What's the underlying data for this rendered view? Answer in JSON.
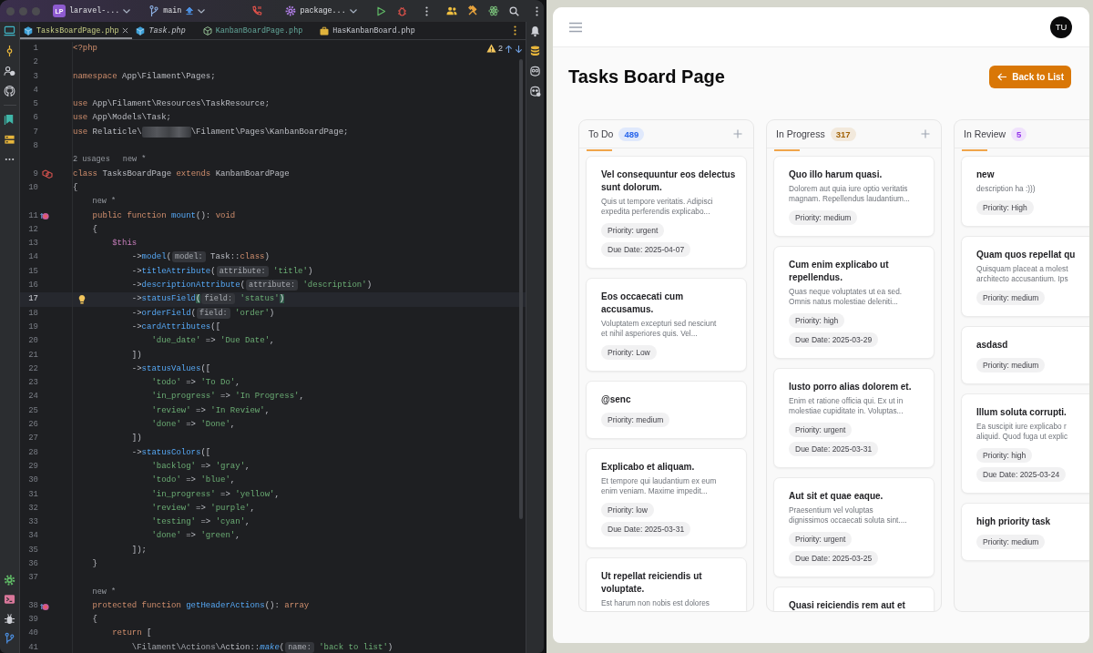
{
  "ide": {
    "title_bar": {
      "project_badge": "LP",
      "project": "laravel-...",
      "branch": "main",
      "run_config": "package..."
    },
    "tabs": [
      {
        "label": "TasksBoardPage.php",
        "kind": "class",
        "selected": true,
        "preview": false,
        "added": true,
        "library": false
      },
      {
        "label": "Task.php",
        "kind": "class",
        "selected": false,
        "preview": true,
        "added": false,
        "library": false
      },
      {
        "label": "KanbanBoardPage.php",
        "kind": "abstract",
        "selected": false,
        "preview": false,
        "added": false,
        "library": true
      },
      {
        "label": "HasKanbanBoard.php",
        "kind": "trait",
        "selected": false,
        "preview": false,
        "added": false,
        "library": false
      }
    ],
    "warnings": "2",
    "lines": [
      {
        "number": "1",
        "kind": "code",
        "current": false,
        "tokens": [
          {
            "text": "<?php",
            "kind": "kw"
          }
        ]
      },
      {
        "number": "2",
        "kind": "code",
        "current": false
      },
      {
        "number": "3",
        "kind": "code",
        "current": false,
        "tokens": [
          {
            "text": "namespace",
            "kind": "kw"
          },
          {
            "text": " App\\Filament\\Pages;",
            "kind": "id"
          }
        ]
      },
      {
        "number": "4",
        "kind": "code",
        "current": false
      },
      {
        "number": "5",
        "kind": "code",
        "current": false,
        "tokens": [
          {
            "text": "use",
            "kind": "kw"
          },
          {
            "text": " App\\Filament\\Resources\\TaskResource;",
            "kind": "id"
          }
        ]
      },
      {
        "number": "6",
        "kind": "code",
        "current": false,
        "tokens": [
          {
            "text": "use",
            "kind": "kw"
          },
          {
            "text": " App\\Models\\Task;",
            "kind": "id"
          }
        ]
      },
      {
        "number": "7",
        "kind": "code",
        "current": false,
        "tokens": [
          {
            "text": "use",
            "kind": "kw"
          },
          {
            "text": " Relaticle\\",
            "kind": "id"
          },
          {
            "kind": "redacted"
          },
          {
            "text": "\\Filament\\Pages\\KanbanBoardPage;",
            "kind": "id"
          }
        ]
      },
      {
        "number": "8",
        "kind": "code",
        "current": false
      },
      {
        "number": "9",
        "kind": "class",
        "current": false,
        "inlay": [
          "2 usages",
          "new *"
        ],
        "tokens": [
          {
            "text": "class",
            "kind": "kw"
          },
          {
            "text": " TasksBoardPage ",
            "kind": "id"
          },
          {
            "text": "extends",
            "kind": "kw"
          },
          {
            "text": " KanbanBoardPage",
            "kind": "id"
          }
        ]
      },
      {
        "number": "10",
        "kind": "code",
        "current": false,
        "tokens": [
          {
            "text": "{",
            "kind": "id"
          }
        ]
      },
      {
        "number": "11",
        "kind": "method",
        "current": false,
        "inlay": [
          "new *"
        ],
        "tokens": [
          {
            "text": "    public function ",
            "kind": "kw"
          },
          {
            "text": "mount",
            "kind": "fn"
          },
          {
            "text": "(): ",
            "kind": "id"
          },
          {
            "text": "void",
            "kind": "kw"
          }
        ]
      },
      {
        "number": "12",
        "kind": "code",
        "current": false,
        "tokens": [
          {
            "text": "    {",
            "kind": "id"
          }
        ]
      },
      {
        "number": "13",
        "kind": "code",
        "current": false,
        "tokens": [
          {
            "text": "        $this",
            "kind": "var"
          }
        ]
      },
      {
        "number": "14",
        "kind": "code",
        "current": false,
        "tokens": [
          {
            "text": "            ->",
            "kind": "id"
          },
          {
            "text": "model",
            "kind": "fn"
          },
          {
            "text": "(",
            "kind": "id"
          },
          {
            "text": "model:",
            "kind": "hint"
          },
          {
            "text": " Task::",
            "kind": "id"
          },
          {
            "text": "class",
            "kind": "kw"
          },
          {
            "text": ")",
            "kind": "id"
          }
        ]
      },
      {
        "number": "15",
        "kind": "code",
        "current": false,
        "tokens": [
          {
            "text": "            ->",
            "kind": "id"
          },
          {
            "text": "titleAttribute",
            "kind": "fn"
          },
          {
            "text": "(",
            "kind": "id"
          },
          {
            "text": "attribute:",
            "kind": "hint"
          },
          {
            "text": " 'title'",
            "kind": "str"
          },
          {
            "text": ")",
            "kind": "id"
          }
        ]
      },
      {
        "number": "16",
        "kind": "code",
        "current": false,
        "tokens": [
          {
            "text": "            ->",
            "kind": "id"
          },
          {
            "text": "descriptionAttribute",
            "kind": "fn"
          },
          {
            "text": "(",
            "kind": "id"
          },
          {
            "text": "attribute:",
            "kind": "hint"
          },
          {
            "text": " 'description'",
            "kind": "str"
          },
          {
            "text": ")",
            "kind": "id"
          }
        ]
      },
      {
        "number": "17",
        "kind": "code",
        "current": true,
        "tokens": [
          {
            "text": "            ->",
            "kind": "id"
          },
          {
            "text": "statusField",
            "kind": "fn"
          },
          {
            "text": "(",
            "kind": "match"
          },
          {
            "text": "field:",
            "kind": "hint"
          },
          {
            "text": " 'status'",
            "kind": "str"
          },
          {
            "text": ")",
            "kind": "match"
          }
        ]
      },
      {
        "number": "18",
        "kind": "code",
        "current": false,
        "tokens": [
          {
            "text": "            ->",
            "kind": "id"
          },
          {
            "text": "orderField",
            "kind": "fn"
          },
          {
            "text": "(",
            "kind": "id"
          },
          {
            "text": "field:",
            "kind": "hint"
          },
          {
            "text": " 'order'",
            "kind": "str"
          },
          {
            "text": ")",
            "kind": "id"
          }
        ]
      },
      {
        "number": "19",
        "kind": "code",
        "current": false,
        "tokens": [
          {
            "text": "            ->",
            "kind": "id"
          },
          {
            "text": "cardAttributes",
            "kind": "fn"
          },
          {
            "text": "([",
            "kind": "id"
          }
        ]
      },
      {
        "number": "20",
        "kind": "code",
        "current": false,
        "tokens": [
          {
            "text": "                'due_date'",
            "kind": "str"
          },
          {
            "text": " => ",
            "kind": "id"
          },
          {
            "text": "'Due Date'",
            "kind": "str"
          },
          {
            "text": ",",
            "kind": "id"
          }
        ]
      },
      {
        "number": "21",
        "kind": "code",
        "current": false,
        "tokens": [
          {
            "text": "            ])",
            "kind": "id"
          }
        ]
      },
      {
        "number": "22",
        "kind": "code",
        "current": false,
        "tokens": [
          {
            "text": "            ->",
            "kind": "id"
          },
          {
            "text": "statusValues",
            "kind": "fn"
          },
          {
            "text": "([",
            "kind": "id"
          }
        ]
      },
      {
        "number": "23",
        "kind": "code",
        "current": false,
        "tokens": [
          {
            "text": "                'todo'",
            "kind": "str"
          },
          {
            "text": " => ",
            "kind": "id"
          },
          {
            "text": "'To Do'",
            "kind": "str"
          },
          {
            "text": ",",
            "kind": "id"
          }
        ]
      },
      {
        "number": "24",
        "kind": "code",
        "current": false,
        "tokens": [
          {
            "text": "                'in_progress'",
            "kind": "str"
          },
          {
            "text": " => ",
            "kind": "id"
          },
          {
            "text": "'In Progress'",
            "kind": "str"
          },
          {
            "text": ",",
            "kind": "id"
          }
        ]
      },
      {
        "number": "25",
        "kind": "code",
        "current": false,
        "tokens": [
          {
            "text": "                'review'",
            "kind": "str"
          },
          {
            "text": " => ",
            "kind": "id"
          },
          {
            "text": "'In Review'",
            "kind": "str"
          },
          {
            "text": ",",
            "kind": "id"
          }
        ]
      },
      {
        "number": "26",
        "kind": "code",
        "current": false,
        "tokens": [
          {
            "text": "                'done'",
            "kind": "str"
          },
          {
            "text": " => ",
            "kind": "id"
          },
          {
            "text": "'Done'",
            "kind": "str"
          },
          {
            "text": ",",
            "kind": "id"
          }
        ]
      },
      {
        "number": "27",
        "kind": "code",
        "current": false,
        "tokens": [
          {
            "text": "            ])",
            "kind": "id"
          }
        ]
      },
      {
        "number": "28",
        "kind": "code",
        "current": false,
        "tokens": [
          {
            "text": "            ->",
            "kind": "id"
          },
          {
            "text": "statusColors",
            "kind": "fn"
          },
          {
            "text": "([",
            "kind": "id"
          }
        ]
      },
      {
        "number": "29",
        "kind": "code",
        "current": false,
        "tokens": [
          {
            "text": "                'backlog'",
            "kind": "str"
          },
          {
            "text": " => ",
            "kind": "id"
          },
          {
            "text": "'gray'",
            "kind": "str"
          },
          {
            "text": ",",
            "kind": "id"
          }
        ]
      },
      {
        "number": "30",
        "kind": "code",
        "current": false,
        "tokens": [
          {
            "text": "                'todo'",
            "kind": "str"
          },
          {
            "text": " => ",
            "kind": "id"
          },
          {
            "text": "'blue'",
            "kind": "str"
          },
          {
            "text": ",",
            "kind": "id"
          }
        ]
      },
      {
        "number": "31",
        "kind": "code",
        "current": false,
        "tokens": [
          {
            "text": "                'in_progress'",
            "kind": "str"
          },
          {
            "text": " => ",
            "kind": "id"
          },
          {
            "text": "'yellow'",
            "kind": "str"
          },
          {
            "text": ",",
            "kind": "id"
          }
        ]
      },
      {
        "number": "32",
        "kind": "code",
        "current": false,
        "tokens": [
          {
            "text": "                'review'",
            "kind": "str"
          },
          {
            "text": " => ",
            "kind": "id"
          },
          {
            "text": "'purple'",
            "kind": "str"
          },
          {
            "text": ",",
            "kind": "id"
          }
        ]
      },
      {
        "number": "33",
        "kind": "code",
        "current": false,
        "tokens": [
          {
            "text": "                'testing'",
            "kind": "str"
          },
          {
            "text": " => ",
            "kind": "id"
          },
          {
            "text": "'cyan'",
            "kind": "str"
          },
          {
            "text": ",",
            "kind": "id"
          }
        ]
      },
      {
        "number": "34",
        "kind": "code",
        "current": false,
        "tokens": [
          {
            "text": "                'done'",
            "kind": "str"
          },
          {
            "text": " => ",
            "kind": "id"
          },
          {
            "text": "'green'",
            "kind": "str"
          },
          {
            "text": ",",
            "kind": "id"
          }
        ]
      },
      {
        "number": "35",
        "kind": "code",
        "current": false,
        "tokens": [
          {
            "text": "            ]);",
            "kind": "id"
          }
        ]
      },
      {
        "number": "36",
        "kind": "code",
        "current": false,
        "tokens": [
          {
            "text": "    }",
            "kind": "id"
          }
        ]
      },
      {
        "number": "37",
        "kind": "code",
        "current": false
      },
      {
        "number": "38",
        "kind": "method",
        "current": false,
        "inlay": [
          "new *"
        ],
        "tokens": [
          {
            "text": "    protected function ",
            "kind": "kw"
          },
          {
            "text": "getHeaderActions",
            "kind": "fn"
          },
          {
            "text": "(): ",
            "kind": "id"
          },
          {
            "text": "array",
            "kind": "kw"
          }
        ]
      },
      {
        "number": "39",
        "kind": "code",
        "current": false,
        "tokens": [
          {
            "text": "    {",
            "kind": "id"
          }
        ]
      },
      {
        "number": "40",
        "kind": "code",
        "current": false,
        "tokens": [
          {
            "text": "        return",
            "kind": "kw"
          },
          {
            "text": " [",
            "kind": "id"
          }
        ]
      },
      {
        "number": "41",
        "kind": "code",
        "current": false,
        "tokens": [
          {
            "text": "            \\Filament\\Actions\\",
            "kind": "dim"
          },
          {
            "text": "Action::",
            "kind": "id"
          },
          {
            "text": "make",
            "kind": "static"
          },
          {
            "text": "(",
            "kind": "id"
          },
          {
            "text": "name:",
            "kind": "hint"
          },
          {
            "text": " 'back to list'",
            "kind": "str"
          },
          {
            "text": ")",
            "kind": "id"
          }
        ]
      }
    ]
  },
  "app": {
    "avatar": "TU",
    "title": "Tasks Board Page",
    "action": "Back to List",
    "columns": [
      {
        "title": "To Do",
        "count": "489",
        "color": "#2563eb",
        "add_button": true,
        "cards": [
          {
            "title": [
              "Vel consequuntur eos delectus",
              "sunt dolorum."
            ],
            "description": [
              "Quis ut tempore veritatis. Adipisci",
              "expedita perferendis explicabo..."
            ],
            "tags": [
              "Priority: urgent",
              "Due Date: 2025-04-07"
            ]
          },
          {
            "title": [
              "Eos occaecati cum",
              "accusamus."
            ],
            "description": [
              "Voluptatem excepturi sed nesciunt",
              "et nihil asperiores quis. Vel..."
            ],
            "tags": [
              "Priority: Low"
            ]
          },
          {
            "title": [
              "@senc"
            ],
            "tags": [
              "Priority: medium"
            ]
          },
          {
            "title": [
              "Explicabo et aliquam."
            ],
            "description": [
              "Et tempore qui laudantium ex eum",
              "enim veniam. Maxime impedit..."
            ],
            "tags": [
              "Priority: low",
              "Due Date: 2025-03-31"
            ]
          },
          {
            "title": [
              "Ut repellat reiciendis ut",
              "voluptate."
            ],
            "description": [
              "Est harum non nobis est dolores"
            ]
          }
        ]
      },
      {
        "title": "In Progress",
        "count": "317",
        "color": "#a16207",
        "add_button": true,
        "cards": [
          {
            "title": [
              "Quo illo harum quasi."
            ],
            "description": [
              "Dolorem aut quia iure optio veritatis",
              "magnam. Repellendus laudantium..."
            ],
            "tags": [
              "Priority: medium"
            ]
          },
          {
            "title": [
              "Cum enim explicabo ut",
              "repellendus."
            ],
            "description": [
              "Quas neque voluptates ut ea sed.",
              "Omnis natus molestiae deleniti..."
            ],
            "tags": [
              "Priority: high",
              "Due Date: 2025-03-29"
            ]
          },
          {
            "title": [
              "Iusto porro alias dolorem et."
            ],
            "description": [
              "Enim et ratione officia qui. Ex ut in",
              "molestiae cupiditate in. Voluptas..."
            ],
            "tags": [
              "Priority: urgent",
              "Due Date: 2025-03-31"
            ]
          },
          {
            "title": [
              "Aut sit et quae eaque."
            ],
            "description": [
              "Praesentium vel voluptas",
              "dignissimos occaecati soluta sint...."
            ],
            "tags": [
              "Priority: urgent",
              "Due Date: 2025-03-25"
            ]
          },
          {
            "title": [
              "Quasi reiciendis rem aut et"
            ]
          }
        ]
      },
      {
        "title": "In Review",
        "count": "5",
        "color": "#9333ea",
        "add_button": false,
        "cards": [
          {
            "title": [
              "new"
            ],
            "description": [
              "description ha :)))"
            ],
            "tags": [
              "Priority: High"
            ]
          },
          {
            "title": [
              "Quam quos repellat qu"
            ],
            "description": [
              "Quisquam placeat a molest",
              "architecto accusantium. Ips"
            ],
            "tags": [
              "Priority: medium"
            ]
          },
          {
            "title": [
              "asdasd"
            ],
            "tags": [
              "Priority: medium"
            ]
          },
          {
            "title": [
              "Illum soluta corrupti."
            ],
            "description": [
              "Ea suscipit iure explicabo r",
              "aliquid. Quod fuga ut explic"
            ],
            "tags": [
              "Priority: high",
              "Due Date: 2025-03-24"
            ]
          },
          {
            "title": [
              "high priority task"
            ],
            "tags": [
              "Priority: medium"
            ]
          }
        ]
      }
    ]
  }
}
